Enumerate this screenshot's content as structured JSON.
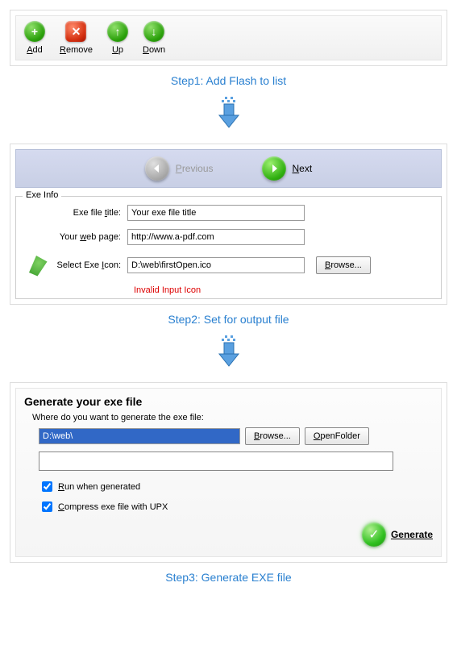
{
  "step1": {
    "title": "Step1: Add Flash to list",
    "toolbar": {
      "add": "Add",
      "remove": "Remove",
      "up": "Up",
      "down": "Down"
    }
  },
  "step2": {
    "title": "Step2: Set for output file",
    "nav": {
      "previous": "Previous",
      "next": "Next"
    },
    "exeInfo": {
      "legend": "Exe Info",
      "titleLabel": "Exe file title:",
      "titleValue": "Your exe file title",
      "webLabel": "Your web page:",
      "webValue": "http://www.a-pdf.com",
      "iconLabel": "Select Exe Icon:",
      "iconValue": "D:\\web\\firstOpen.ico",
      "browse": "Browse...",
      "error": "Invalid Input Icon"
    }
  },
  "step3": {
    "title": "Step3: Generate EXE file",
    "genTitle": "Generate your exe file",
    "genSub": "Where do you want to generate the exe file:",
    "pathValue": "D:\\web\\",
    "browse": "Browse...",
    "openFolder": "OpenFolder",
    "runWhenGenerated": "Run when generated",
    "compressUpx": "Compress exe file with UPX",
    "generate": "Generate",
    "runChecked": true,
    "compressChecked": true
  }
}
